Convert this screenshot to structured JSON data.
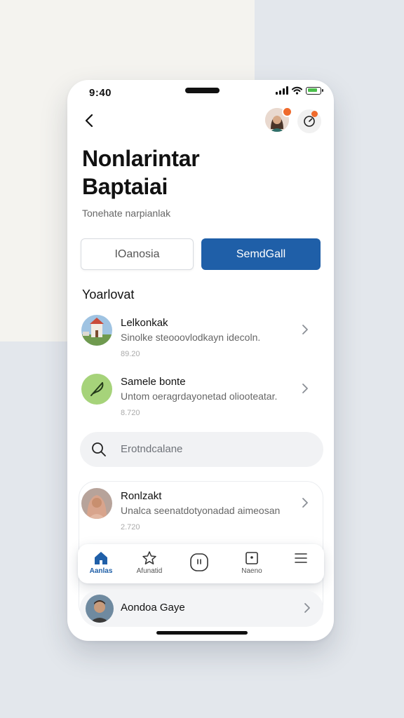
{
  "status_bar": {
    "time": "9:40"
  },
  "header": {
    "title_line1": "Nonlarintar",
    "title_line2": "Baptaiai",
    "subtitle": "Tonehate narpianlak"
  },
  "actions": {
    "secondary_label": "IOanosia",
    "primary_label": "SemdGall"
  },
  "section": {
    "title": "Yoarlovat"
  },
  "list": {
    "items": [
      {
        "title": "Lelkonkak",
        "subtitle": "Sinolke steooovlodkayn idecoln.",
        "meta": "89.20"
      },
      {
        "title": "Samele bonte",
        "subtitle": "Untom oeragrdayonetad oliooteatar.",
        "meta": "8.720"
      },
      {
        "title": "Ronlzakt",
        "subtitle": "Unalca seenatdotyonadad aimeosan",
        "meta": "2.720"
      }
    ]
  },
  "search": {
    "placeholder": "Erotndcalane"
  },
  "tabbar": {
    "tabs": [
      {
        "label": "Aanlas",
        "icon": "home-icon"
      },
      {
        "label": "Afunatid",
        "icon": "star-icon"
      },
      {
        "label": "",
        "icon": "chat-icon"
      },
      {
        "label": "Naeno",
        "icon": "inbox-icon"
      },
      {
        "label": "",
        "icon": "menu-icon"
      }
    ]
  },
  "bottom_item": {
    "title": "Aondoa Gaye"
  },
  "colors": {
    "accent": "#1f5fa8",
    "badge": "#ef6a2c",
    "icon_green": "#a6d37a"
  }
}
